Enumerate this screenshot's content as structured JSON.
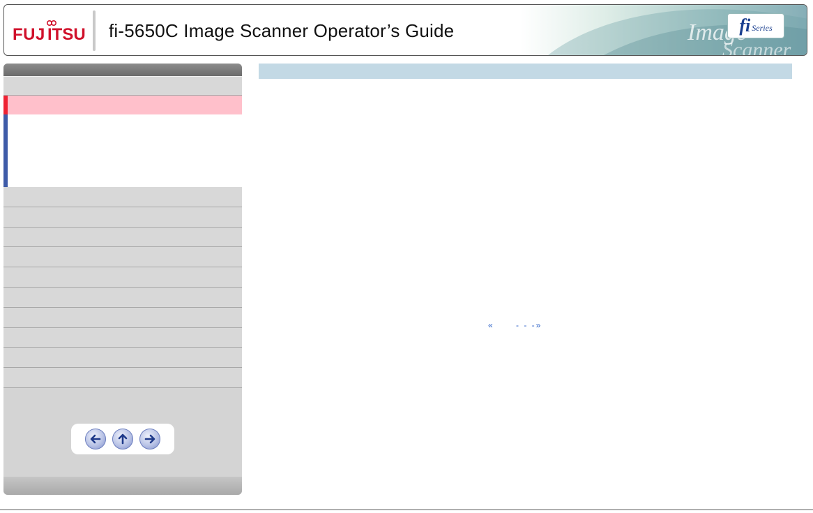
{
  "header": {
    "logo_text": "FUJITSU",
    "title": "fi-5650C Image Scanner Operator’s Guide",
    "badge_fi": "fi",
    "badge_series": "Series",
    "banner_words": [
      "Image",
      "Scanner"
    ]
  },
  "sidebar": {
    "items_top": [
      ""
    ],
    "active_item": "",
    "items_lower": [
      "",
      "",
      "",
      "",
      "",
      "",
      "",
      "",
      "",
      "",
      ""
    ],
    "nav_buttons": [
      "back-icon",
      "up-icon",
      "forward-icon"
    ]
  },
  "content": {
    "heading": "",
    "pager": {
      "prev": "«",
      "separator": "- - -",
      "next": "»"
    }
  },
  "colors": {
    "sidebar_bg": "#d4d4d4",
    "active_item_bg": "#ffc0cb",
    "active_marker": "#ee2233",
    "sub_marker": "#3e5ba8",
    "content_bar": "#c3d9e5",
    "link": "#2f63c8"
  }
}
